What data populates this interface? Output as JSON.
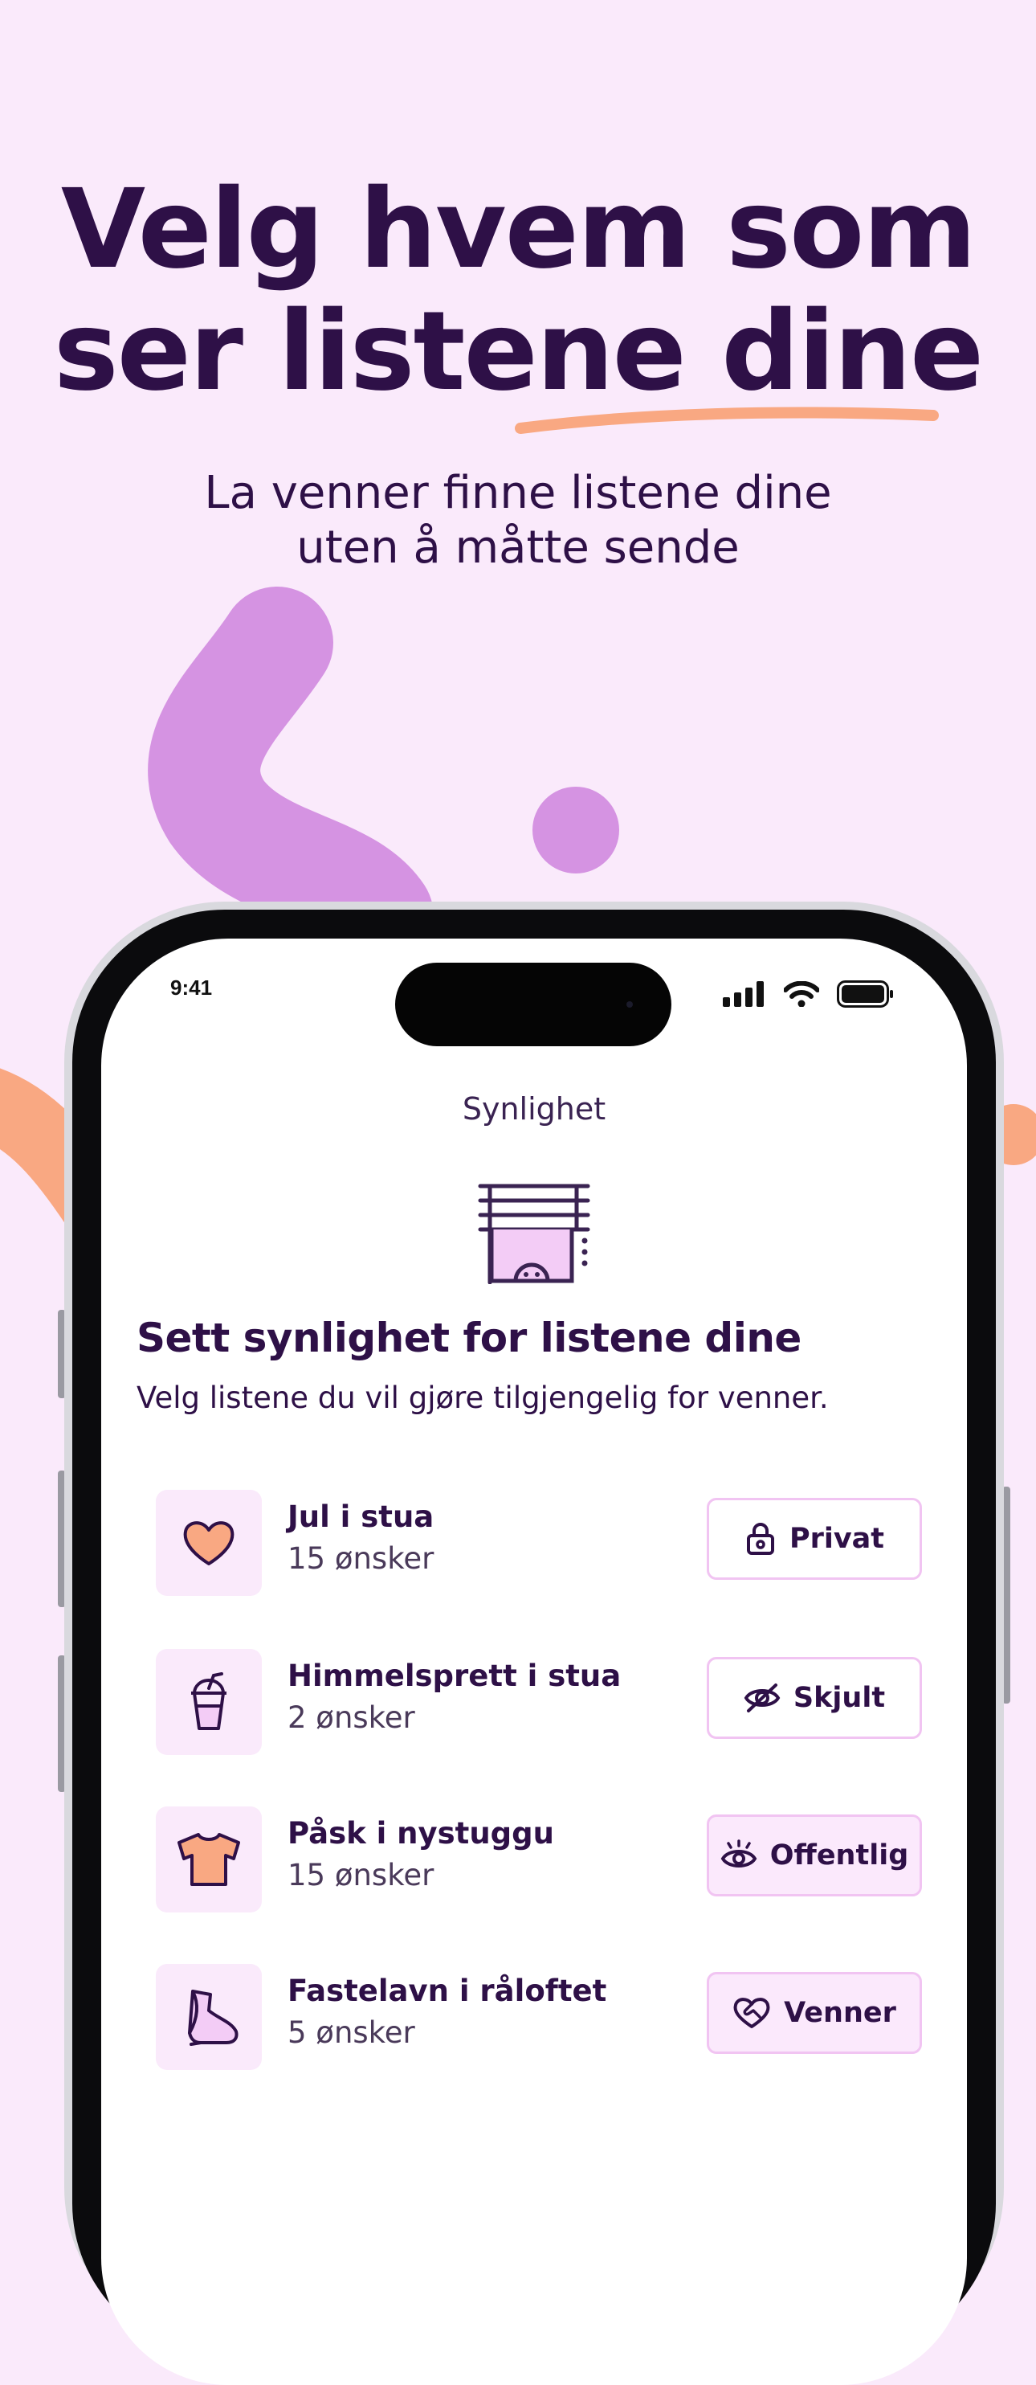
{
  "headline": {
    "line1": "Velg hvem som",
    "line2": "ser listene dine"
  },
  "subheadline": {
    "line1": "La venner finne listene dine",
    "line2": "uten å måtte sende"
  },
  "colors": {
    "background": "#FAEAFB",
    "text": "#2E1047",
    "blob_purple": "#D593E2",
    "accent_orange": "#F9A882",
    "button_border": "#F1C4F2"
  },
  "status_bar": {
    "time": "9:41",
    "icons": [
      "signal-icon",
      "wifi-icon",
      "battery-icon"
    ]
  },
  "screen": {
    "title": "Synlighet",
    "hero_icon": "blinds-window-icon",
    "section_title": "Sett synlighet for listene dine",
    "section_subtitle": "Velg listene du vil gjøre tilgjengelig for venner.",
    "lists": [
      {
        "name": "Jul i stua",
        "count": "15 ønsker",
        "icon": "heart-icon",
        "visibility": "Privat",
        "visibility_icon": "lock-icon",
        "active": false
      },
      {
        "name": "Himmelsprett i stua",
        "count": "2 ønsker",
        "icon": "cup-icon",
        "visibility": "Skjult",
        "visibility_icon": "eye-off-icon",
        "active": false
      },
      {
        "name": "Påsk i nystuggu",
        "count": "15 ønsker",
        "icon": "tshirt-icon",
        "visibility": "Offentlig",
        "visibility_icon": "eye-icon",
        "active": true
      },
      {
        "name": "Fastelavn i råloftet",
        "count": "5 ønsker",
        "icon": "shoe-icon",
        "visibility": "Venner",
        "visibility_icon": "heart-handshake-icon",
        "active": true
      }
    ]
  }
}
